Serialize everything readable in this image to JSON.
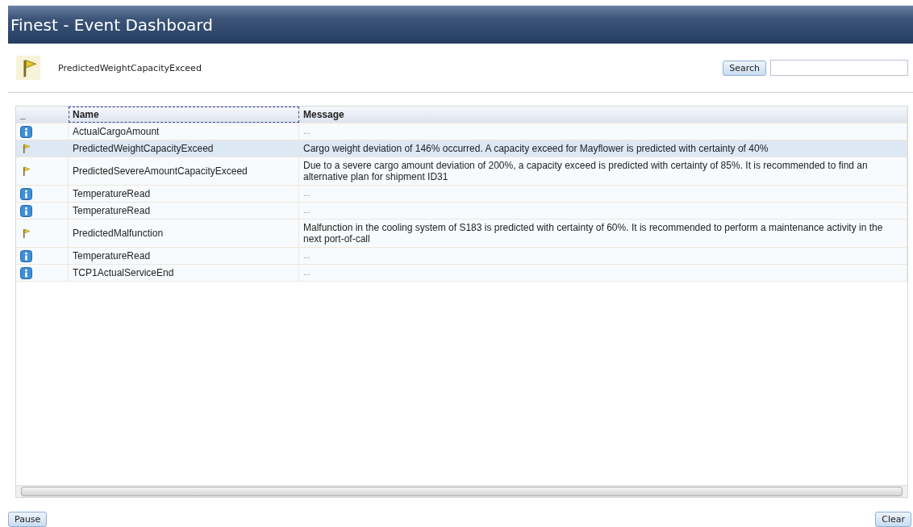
{
  "window": {
    "title": "Finest - Event Dashboard"
  },
  "detail": {
    "kind": "flag",
    "name": "PredictedWeightCapacityExceed"
  },
  "search": {
    "button": "Search"
  },
  "table": {
    "columns": [
      "_",
      "Name",
      "Message"
    ],
    "rows": [
      {
        "kind": "info",
        "name": "ActualCargoAmount",
        "message": "...",
        "selected": false
      },
      {
        "kind": "flag",
        "name": "PredictedWeightCapacityExceed",
        "message": "Cargo weight deviation of 146% occurred. A capacity exceed for Mayflower is predicted with certainty of 40%",
        "selected": true
      },
      {
        "kind": "flag",
        "name": "PredictedSevereAmountCapacityExceed",
        "message": "Due to a severe cargo amount deviation of 200%, a capacity exceed is predicted with certainty of 85%. It is recommended to find an alternative plan for shipment ID31",
        "selected": false
      },
      {
        "kind": "info",
        "name": "TemperatureRead",
        "message": "...",
        "selected": false
      },
      {
        "kind": "info",
        "name": "TemperatureRead",
        "message": "...",
        "selected": false
      },
      {
        "kind": "flag",
        "name": "PredictedMalfunction",
        "message": "Malfunction in the cooling system of S183 is predicted with certainty of 60%. It is recommended to perform a maintenance activity in the next port-of-call",
        "selected": false
      },
      {
        "kind": "info",
        "name": "TemperatureRead",
        "message": "...",
        "selected": false
      },
      {
        "kind": "info",
        "name": "TCP1ActualServiceEnd",
        "message": "...",
        "selected": false
      }
    ]
  },
  "buttons": {
    "pause": "Pause",
    "clear": "Clear"
  }
}
